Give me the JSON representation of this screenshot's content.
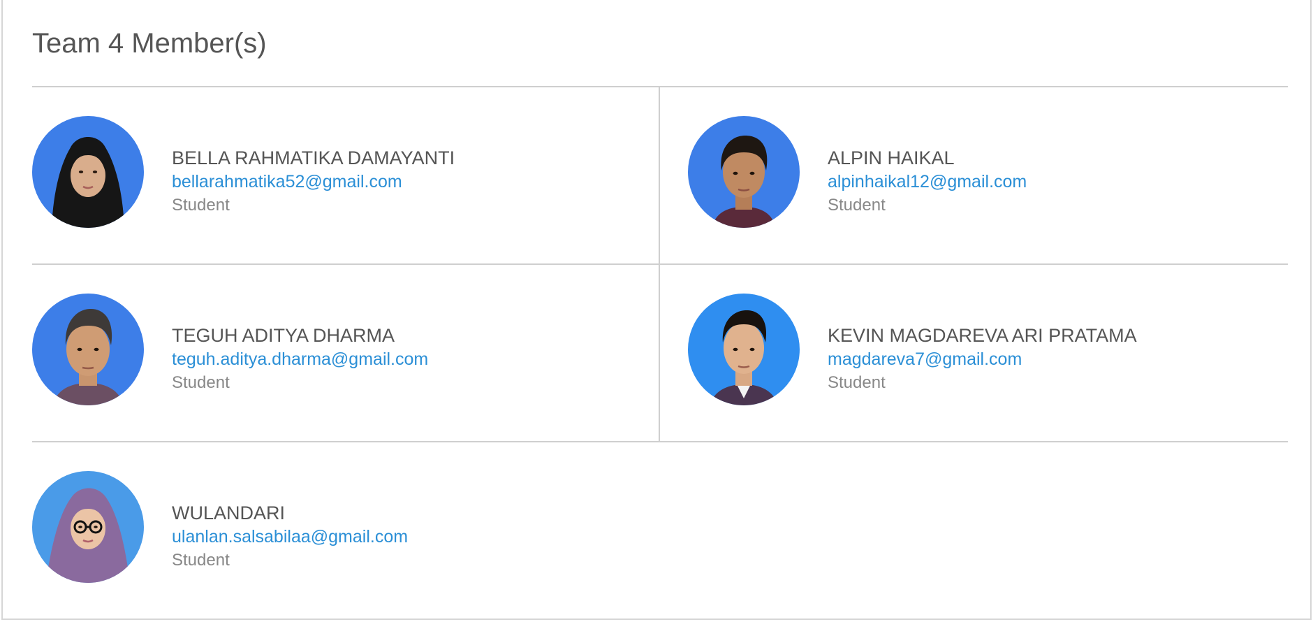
{
  "team": {
    "title": "Team 4 Member(s)"
  },
  "members": [
    {
      "name": "BELLA RAHMATIKA DAMAYANTI",
      "email": "bellarahmatika52@gmail.com",
      "role": "Student",
      "photo_bg": "#3d7ee8"
    },
    {
      "name": "ALPIN HAIKAL",
      "email": "alpinhaikal12@gmail.com",
      "role": "Student",
      "photo_bg": "#3d7ee8"
    },
    {
      "name": "TEGUH ADITYA DHARMA",
      "email": "teguh.aditya.dharma@gmail.com",
      "role": "Student",
      "photo_bg": "#3d7ee8"
    },
    {
      "name": "KEVIN MAGDAREVA ARI PRATAMA",
      "email": "magdareva7@gmail.com",
      "role": "Student",
      "photo_bg": "#2f8ef0"
    },
    {
      "name": "WULANDARI",
      "email": "ulanlan.salsabilaa@gmail.com",
      "role": "Student",
      "photo_bg": "#4a9be8"
    }
  ],
  "colors": {
    "link": "#2b8fd6",
    "text": "#555555",
    "muted": "#888888",
    "divider": "#cfcfcf"
  }
}
